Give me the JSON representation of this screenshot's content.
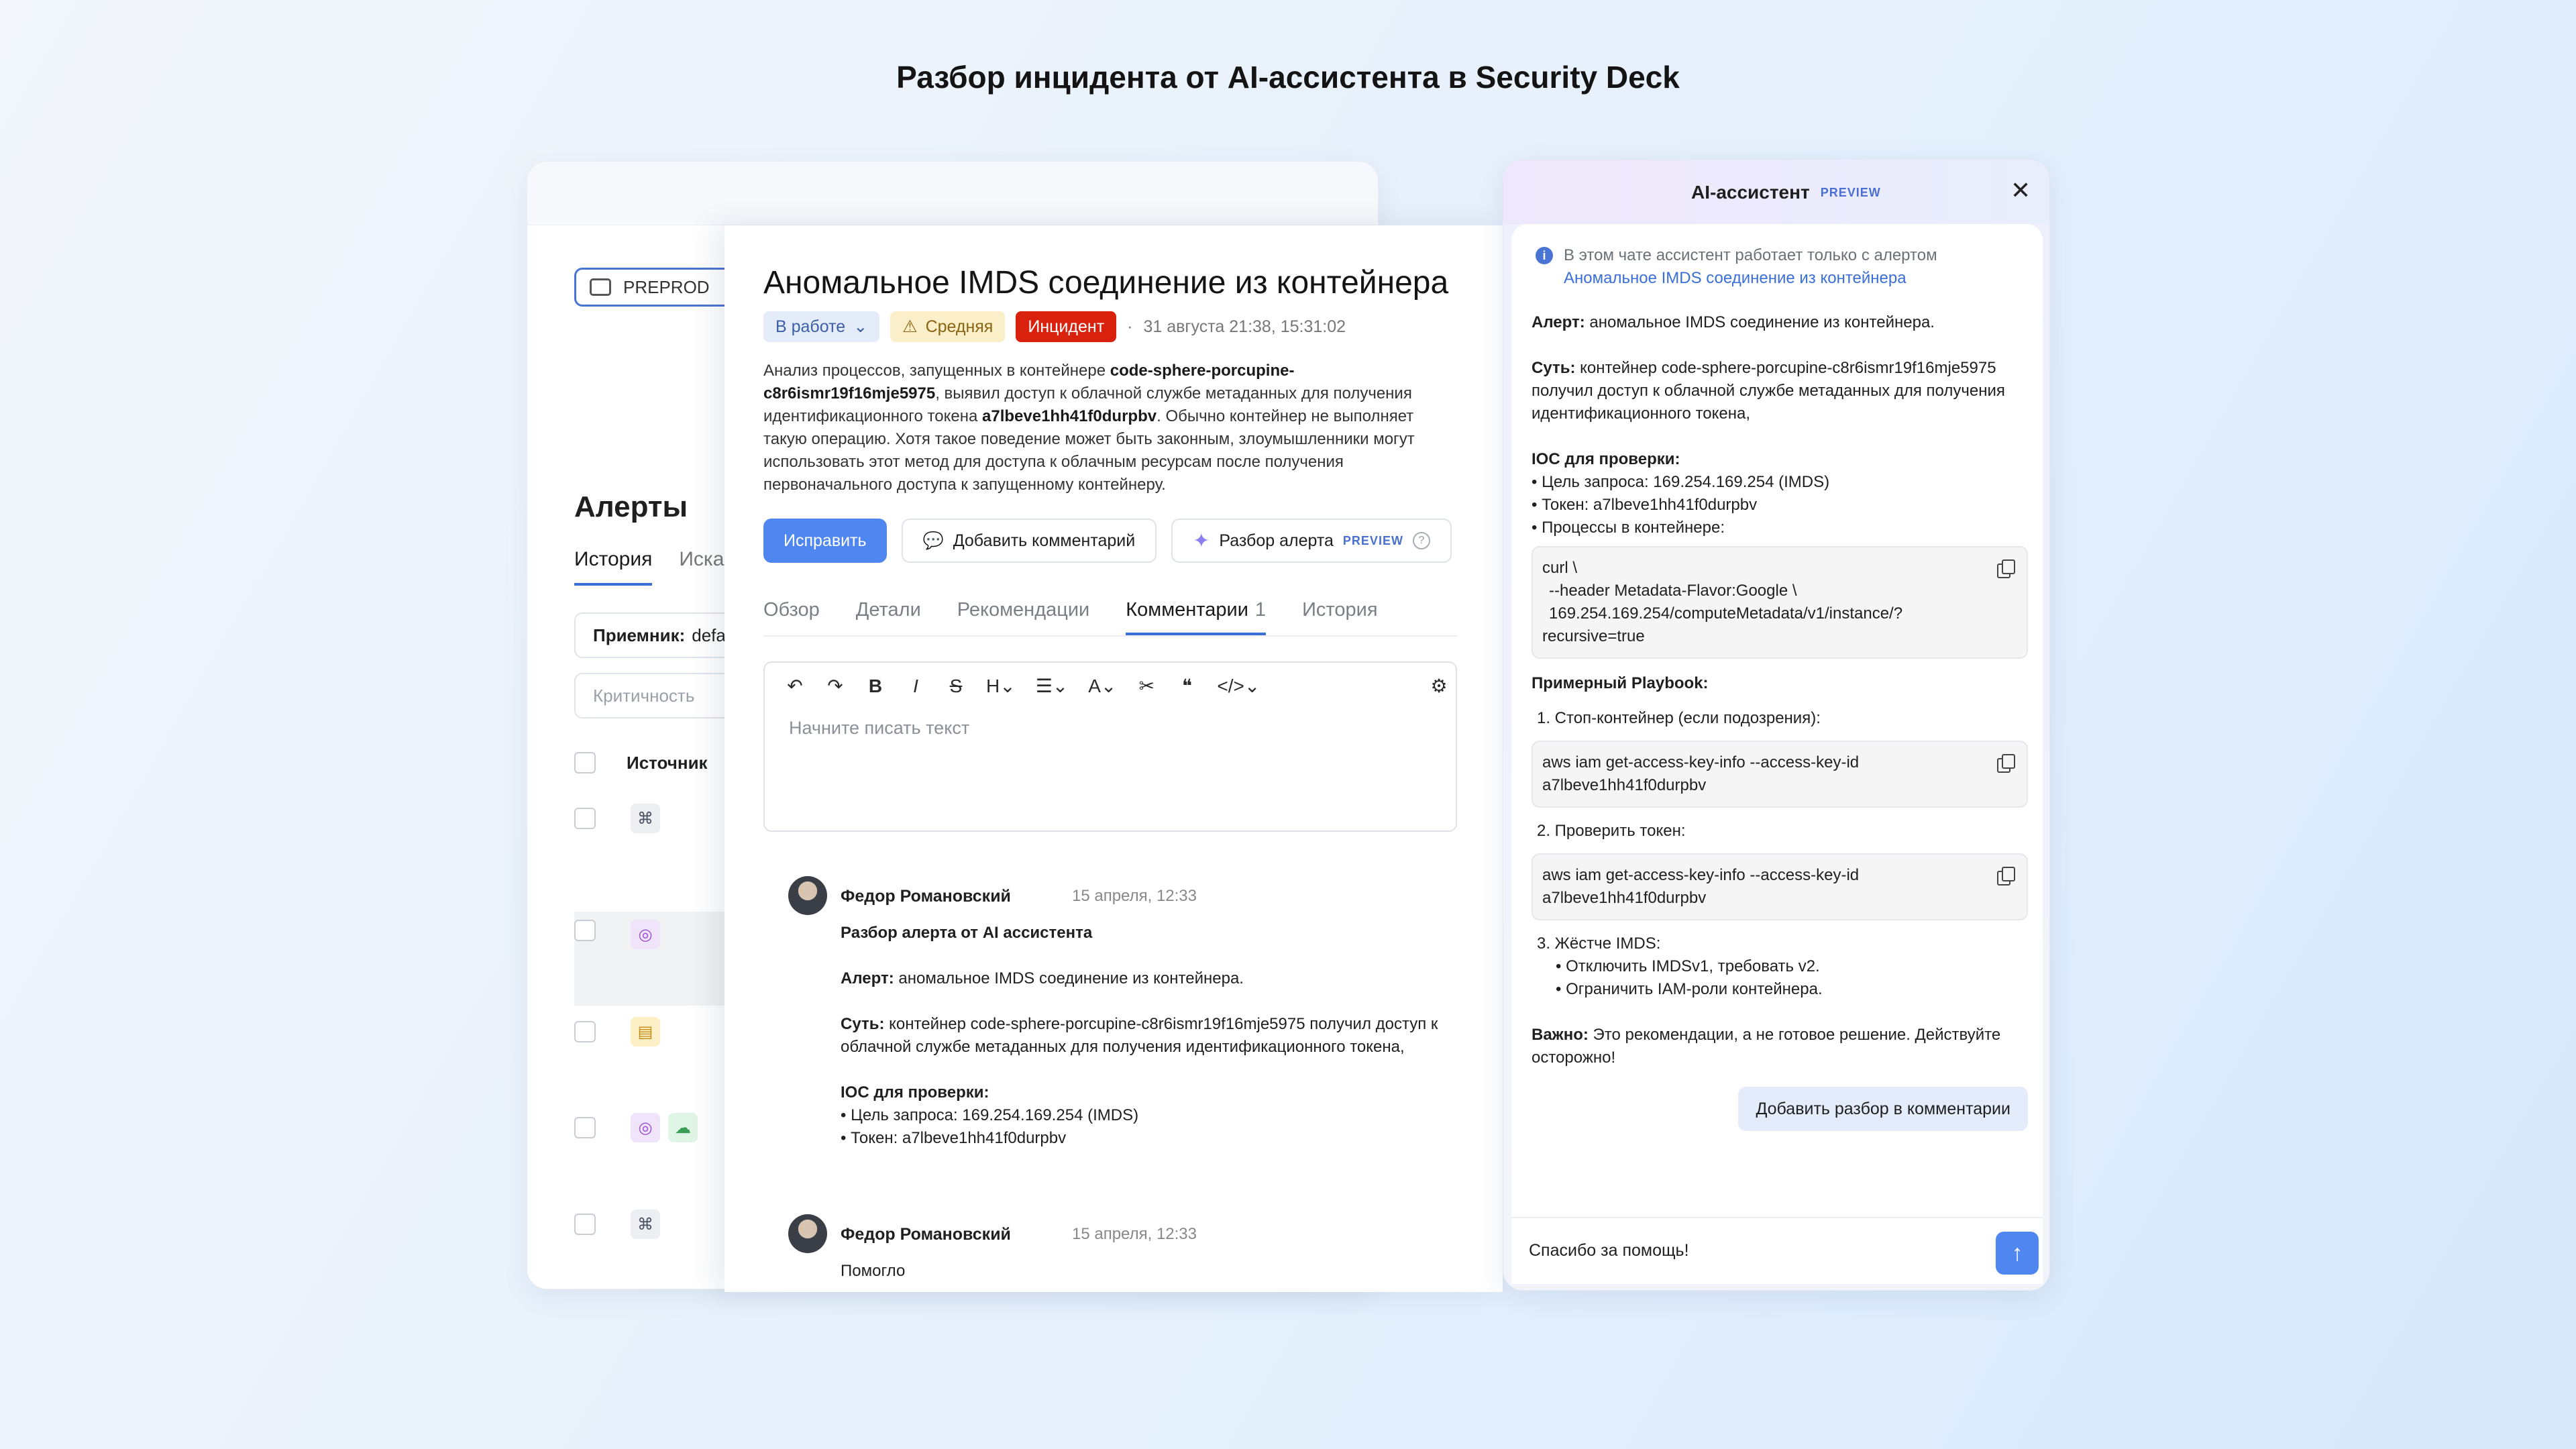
{
  "headline": "Разбор инцидента от AI-ассистента в Security Deck",
  "bg": {
    "workspace": "PREPROD",
    "title": "Алерты",
    "tabs": [
      "История",
      "Иска"
    ],
    "receiver_label": "Приемник:",
    "receiver_value": "defau",
    "criticality_placeholder": "Критичность",
    "source_column": "Источник",
    "rows": [
      {
        "icons": [
          "binoculars-icon"
        ]
      },
      {
        "icons": [
          "target-icon"
        ]
      },
      {
        "icons": [
          "database-icon"
        ]
      },
      {
        "icons": [
          "target-icon",
          "cloud-icon"
        ]
      },
      {
        "icons": [
          "binoculars-icon"
        ]
      },
      {
        "icons": [
          "database-icon"
        ]
      },
      {
        "icons": [
          "binoculars-icon",
          "gear-icon"
        ]
      }
    ]
  },
  "alert": {
    "title": "Аномальное IMDS соединение из контейнера",
    "status": "В работе",
    "severity": "Средняя",
    "type": "Инцидент",
    "dot": "·",
    "date": "31 августа 21:38, 15:31:02",
    "desc_1": "Анализ процессов, запущенных в контейнере ",
    "desc_container": "code-sphere-porcupine-c8r6ismr19f16mje5975",
    "desc_2": ", выявил доступ к облачной службе метаданных для получения идентификационного токена ",
    "desc_token": "a7lbeve1hh41f0durpbv",
    "desc_3": ". Обычно контейнер не выполняет такую операцию. Хотя такое поведение может быть законным, злоумышленники могут использовать этот метод для доступа к облачным ресурсам после получения первоначального доступа к запущенному контейнеру.",
    "actions": {
      "fix": "Исправить",
      "add_comment": "Добавить комментарий",
      "analysis": "Разбор алерта",
      "preview": "PREVIEW"
    },
    "tabs": {
      "overview": "Обзор",
      "details": "Детали",
      "recommendations": "Рекомендации",
      "comments": "Комментарии",
      "comments_count": "1",
      "history": "История"
    },
    "editor_placeholder": "Начните писать текст",
    "comments": [
      {
        "author": "Федор Романовский",
        "time": "15 апреля, 12:33",
        "heading": "Разбор алерта от AI ассистента",
        "alert_label": "Алерт:",
        "alert_text": " аномальное IMDS соединение из контейнера.",
        "essence_label": "Суть:",
        "essence_text": " контейнер code-sphere-porcupine-c8r6ismr19f16mje5975 получил доступ к облачной службе метаданных для получения идентификационного токена,",
        "ioc_label": "IOC для проверки:",
        "ioc_1": "• Цель запроса: 169.254.169.254 (IMDS)",
        "ioc_2": "• Токен: a7lbeve1hh41f0durpbv"
      },
      {
        "author": "Федор Романовский",
        "time": "15 апреля, 12:33",
        "text": "Помогло"
      }
    ]
  },
  "ai": {
    "title": "AI-ассистент",
    "preview": "PREVIEW",
    "info": "В этом чате ассистент работает только с алертом",
    "info_link": "Аномальное IMDS соединение из контейнера",
    "alert_label": "Алерт:",
    "alert_text": " аномальное IMDS соединение из контейнера.",
    "essence_label": "Суть:",
    "essence_text": " контейнер code-sphere-porcupine-c8r6ismr19f16mje5975 получил доступ к облачной службе метаданных для получения идентификационного токена,",
    "ioc_label": "IOC для проверки:",
    "ioc_1": "• Цель запроса: 169.254.169.254 (IMDS)",
    "ioc_2": "• Токен: a7lbeve1hh41f0durpbv",
    "ioc_3": "• Процессы в контейнере:",
    "code_1_l1": "curl \\",
    "code_1_l2": "  --header Metadata-Flavor:Google \\",
    "code_1_l3": "  169.254.169.254/computeMetadata/v1/instance/?",
    "code_1_l4": "recursive=true",
    "playbook_label": "Примерный Playbook:",
    "step_1": "1. Стоп-контейнер (если подозрения):",
    "code_2_l1": "aws iam get-access-key-info --access-key-id",
    "code_2_l2": "a7lbeve1hh41f0durpbv",
    "step_2": "2. Проверить токен:",
    "code_3_l1": "aws iam get-access-key-info --access-key-id",
    "code_3_l2": "a7lbeve1hh41f0durpbv",
    "step_3": "3. Жёстче IMDS:",
    "step_3_a": "• Отключить IMDSv1, требовать v2.",
    "step_3_b": "• Ограничить IAM-роли контейнера.",
    "important_label": "Важно:",
    "important_text": " Это рекомендации, а не готовое решение. Действуйте осторожно!",
    "add_button": "Добавить разбор в комментарии",
    "input_value": "Спасибо за помощь!"
  }
}
